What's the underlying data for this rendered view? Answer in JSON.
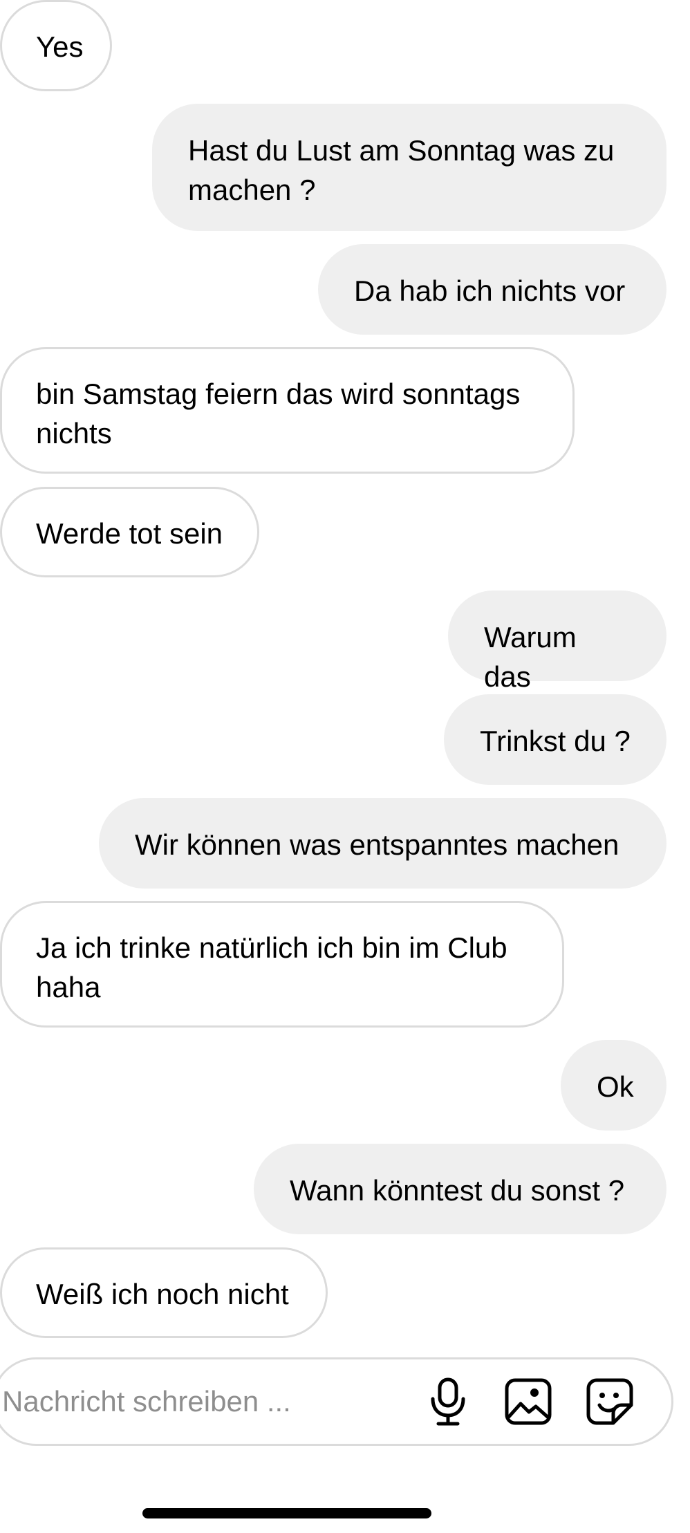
{
  "messages": [
    {
      "direction": "incoming",
      "text": "Yes"
    },
    {
      "direction": "outgoing",
      "text": "Hast du Lust am Sonntag was zu machen ?"
    },
    {
      "direction": "outgoing",
      "text": "Da hab ich nichts vor"
    },
    {
      "direction": "incoming",
      "text": "bin Samstag feiern das wird sonntags nichts"
    },
    {
      "direction": "incoming",
      "text": "Werde tot sein"
    },
    {
      "direction": "outgoing",
      "text": "Warum das"
    },
    {
      "direction": "outgoing",
      "text": "Trinkst du ?"
    },
    {
      "direction": "outgoing",
      "text": "Wir können was entspanntes machen"
    },
    {
      "direction": "incoming",
      "text": "Ja ich trinke natürlich ich bin im Club haha"
    },
    {
      "direction": "outgoing",
      "text": "Ok"
    },
    {
      "direction": "outgoing",
      "text": "Wann könntest du sonst ?"
    },
    {
      "direction": "incoming",
      "text": "Weiß ich noch nicht"
    }
  ],
  "composer": {
    "placeholder": "Nachricht schreiben ...",
    "value": "",
    "icons": [
      "microphone-icon",
      "image-icon",
      "sticker-icon"
    ]
  }
}
